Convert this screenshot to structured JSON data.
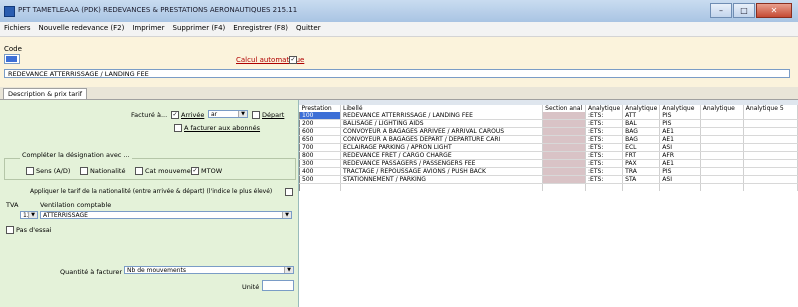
{
  "window": {
    "title": "PFT TAMETLEAAA (PDK) REDEVANCES & PRESTATIONS AERONAUTIQUES 215.11",
    "min_label": "–",
    "max_label": "□",
    "close_label": "✕"
  },
  "menu": [
    "Fichiers",
    "Nouvelle redevance (F2)",
    "Imprimer",
    "Supprimer (F4)",
    "Enregistrer (F8)",
    "Quitter"
  ],
  "form": {
    "code_label": "Code",
    "calcul_label": "Calcul automatique",
    "calcul_checked": "✓",
    "libelle_value": "REDEVANCE ATTERRISSAGE / LANDING FEE"
  },
  "tab_label": "Description & prix tarif",
  "left": {
    "facture_label": "Facturé à...",
    "arrivee_label": "Arrivée",
    "arrivee_checked": "✓",
    "arr_select": "ar",
    "depart_label": "Départ",
    "facturer_label": "A facturer aux abonnés",
    "group_title": "Compléter la désignation avec ...",
    "sens_label": "Sens (A/D)",
    "nationalite_label": "Nationalité",
    "cat_label": "Cat mouvement",
    "mtow_label": "MTOW",
    "mtow_checked": "✓",
    "appliquer_label": "Appliquer le tarif de la nationalité (entre arrivée & départ) (l'indice le plus élevé)",
    "tva_label": "TVA",
    "ventilation_label": "Ventilation comptable",
    "tva_value": "13",
    "ventilation_value": "ATTERRISSAGE",
    "pas_label": "Pas d'essai",
    "quantite_label": "Quantité à facturer",
    "quantite_value": "Nb de mouvements",
    "unite_label": "Unité"
  },
  "table": {
    "headers": [
      "Prestation",
      "Libellé",
      "Section anal",
      "Analytique",
      "Analytique",
      "Analytique",
      "Analytique",
      "Analytique 5"
    ],
    "rows": [
      [
        "100",
        "REDEVANCE ATTERRISSAGE / LANDING FEE",
        "",
        ":ETS:",
        "ATT",
        "PIS",
        "",
        ""
      ],
      [
        "200",
        "BALISAGE / LIGHTING AIDS",
        "",
        ":ETS:",
        "BAL",
        "PIS",
        "",
        ""
      ],
      [
        "600",
        "CONVOYEUR A BAGAGES ARRIVEE / ARRIVAL CAROUS",
        "",
        ":ETS:",
        "BAG",
        "AE1",
        "",
        ""
      ],
      [
        "650",
        "CONVOYEUR A BAGAGES DEPART / DEPARTURE CARI",
        "",
        ":ETS:",
        "BAG",
        "AE1",
        "",
        ""
      ],
      [
        "700",
        "ECLAIRAGE PARKING / APRON LIGHT",
        "",
        ":ETS:",
        "ECL",
        "ASI",
        "",
        ""
      ],
      [
        "800",
        "REDEVANCE FRET / CARGO CHARGE",
        "",
        ":ETS:",
        "FRT",
        "AFR",
        "",
        ""
      ],
      [
        "300",
        "REDEVANCE PASSAGERS / PASSENGERS FEE",
        "",
        ":ETS:",
        "PAX",
        "AE1",
        "",
        ""
      ],
      [
        "400",
        "TRACTAGE / REPOUSSAGE AVIONS / PUSH BACK",
        "",
        ":ETS:",
        "TRA",
        "PIS",
        "",
        ""
      ],
      [
        "500",
        "STATIONNEMENT / PARKING",
        "",
        ":ETS:",
        "STA",
        "ASI",
        "",
        ""
      ]
    ]
  }
}
